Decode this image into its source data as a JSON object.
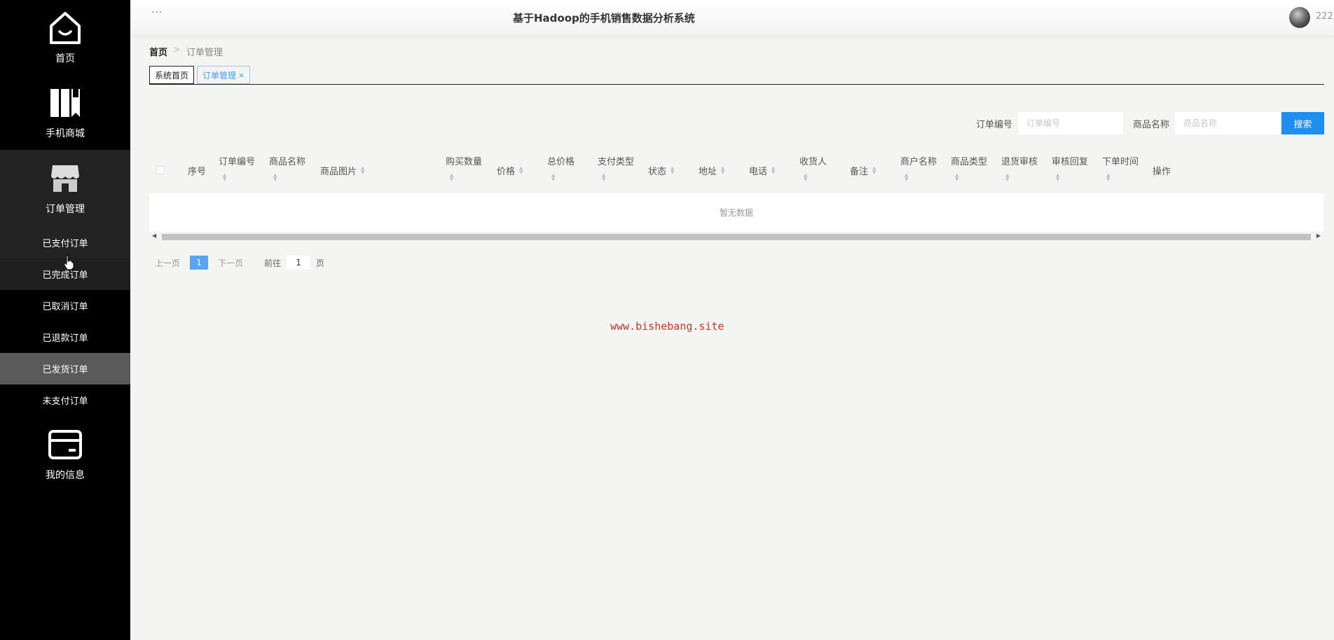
{
  "sidebar": {
    "items": [
      {
        "label": "首页",
        "icon": "home-icon"
      },
      {
        "label": "手机商城",
        "icon": "book-icon"
      },
      {
        "label": "订单管理",
        "icon": "shop-icon"
      },
      {
        "label": "我的信息",
        "icon": "card-icon"
      }
    ],
    "sub_items": [
      "已支付订单",
      "已完成订单",
      "已取消订单",
      "已退款订单",
      "已发货订单",
      "未支付订单"
    ]
  },
  "header": {
    "menu_dots": "···",
    "title": "基于Hadoop的手机销售数据分析系统",
    "username": "222"
  },
  "breadcrumb": {
    "home": "首页",
    "separator": ">",
    "current": "订单管理"
  },
  "tabs": [
    {
      "label": "系统首页"
    },
    {
      "label": "订单管理",
      "close": "×"
    }
  ],
  "search": {
    "order_no_label": "订单编号",
    "order_no_placeholder": "订单编号",
    "product_label": "商品名称",
    "product_placeholder": "商品名称",
    "button": "搜索"
  },
  "table": {
    "columns": [
      "序号",
      "订单编号",
      "商品名称",
      "商品图片",
      "购买数量",
      "价格",
      "总价格",
      "支付类型",
      "状态",
      "地址",
      "电话",
      "收货人",
      "备注",
      "商户名称",
      "商品类型",
      "退货审核",
      "审核回复",
      "下单时间",
      "操作"
    ],
    "empty_text": "暂无数据"
  },
  "pagination": {
    "prev": "上一页",
    "current": "1",
    "next": "下一页",
    "goto_label": "前往",
    "goto_value": "1",
    "goto_unit": "页"
  },
  "watermark": "www.bishebang.site"
}
